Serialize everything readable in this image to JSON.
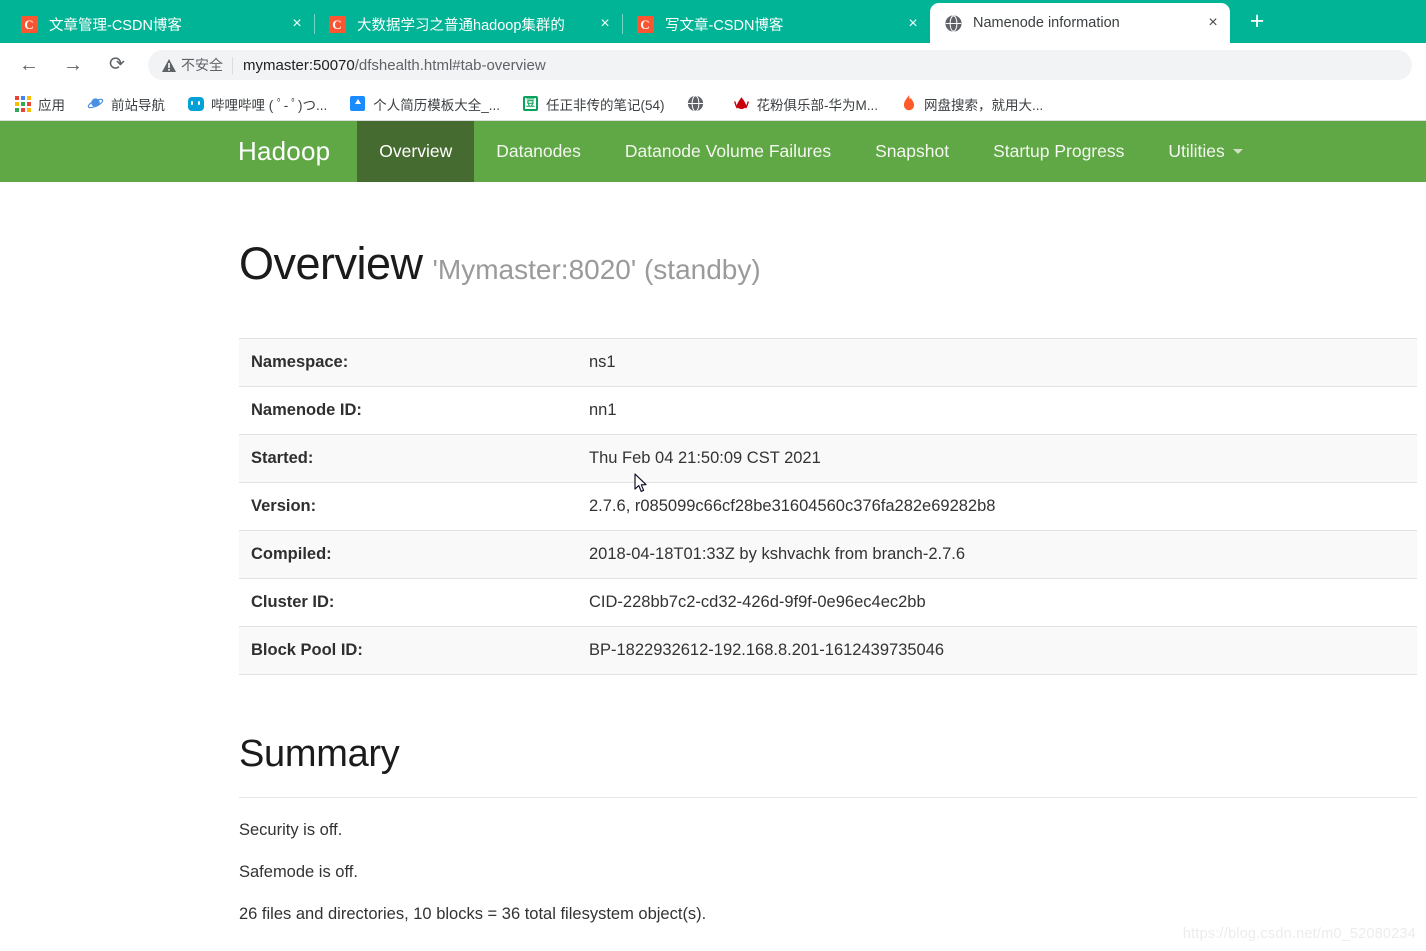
{
  "browser": {
    "tabs": [
      {
        "title": "文章管理-CSDN博客",
        "icon": "csdn-icon",
        "active": false,
        "close_label": "×"
      },
      {
        "title": "大数据学习之普通hadoop集群的",
        "icon": "csdn-icon",
        "active": false,
        "close_label": "×"
      },
      {
        "title": "写文章-CSDN博客",
        "icon": "csdn-icon",
        "active": false,
        "close_label": "×"
      },
      {
        "title": "Namenode information",
        "icon": "globe-icon",
        "active": true,
        "close_label": "×"
      }
    ],
    "new_tab_label": "+",
    "toolbar": {
      "back_icon": "←",
      "forward_icon": "→",
      "reload_icon": "⟳",
      "security_label": "不安全",
      "url_host": "mymaster:50070",
      "url_path": "/dfshealth.html#tab-overview",
      "url_full": "mymaster:50070/dfshealth.html#tab-overview"
    },
    "bookmarks": [
      {
        "label": "应用",
        "icon": "apps-grid-icon"
      },
      {
        "label": "前站导航",
        "icon": "planet-icon"
      },
      {
        "label": "哔哩哔哩 ( ﾟ- ﾟ)つ...",
        "icon": "bilibili-icon"
      },
      {
        "label": "个人简历模板大全_...",
        "icon": "resume-icon"
      },
      {
        "label": "任正非传的笔记(54)",
        "icon": "douban-icon"
      },
      {
        "label": "",
        "icon": "globe-icon"
      },
      {
        "label": "花粉俱乐部-华为M...",
        "icon": "huawei-icon"
      },
      {
        "label": "网盘搜索，就用大...",
        "icon": "fire-icon"
      }
    ],
    "colors": {
      "tabstrip": "#00b495",
      "csdn_favicon": "#fc5531"
    }
  },
  "hadoop": {
    "brand": "Hadoop",
    "nav": [
      {
        "label": "Overview",
        "active": true
      },
      {
        "label": "Datanodes",
        "active": false
      },
      {
        "label": "Datanode Volume Failures",
        "active": false
      },
      {
        "label": "Snapshot",
        "active": false
      },
      {
        "label": "Startup Progress",
        "active": false
      },
      {
        "label": "Utilities",
        "active": false,
        "dropdown": true
      }
    ],
    "nav_colors": {
      "bar": "#5fa845",
      "active": "#466b30"
    },
    "overview": {
      "title": "Overview",
      "subtitle": "'Mymaster:8020' (standby)",
      "rows": [
        {
          "label": "Namespace:",
          "value": "ns1"
        },
        {
          "label": "Namenode ID:",
          "value": "nn1"
        },
        {
          "label": "Started:",
          "value": "Thu Feb 04 21:50:09 CST 2021"
        },
        {
          "label": "Version:",
          "value": "2.7.6, r085099c66cf28be31604560c376fa282e69282b8"
        },
        {
          "label": "Compiled:",
          "value": "2018-04-18T01:33Z by kshvachk from branch-2.7.6"
        },
        {
          "label": "Cluster ID:",
          "value": "CID-228bb7c2-cd32-426d-9f9f-0e96ec4ec2bb"
        },
        {
          "label": "Block Pool ID:",
          "value": "BP-1822932612-192.168.8.201-1612439735046"
        }
      ]
    },
    "summary": {
      "title": "Summary",
      "lines": [
        "Security is off.",
        "Safemode is off.",
        "26 files and directories, 10 blocks = 36 total filesystem object(s)."
      ]
    }
  },
  "watermark": "https://blog.csdn.net/m0_52080234"
}
